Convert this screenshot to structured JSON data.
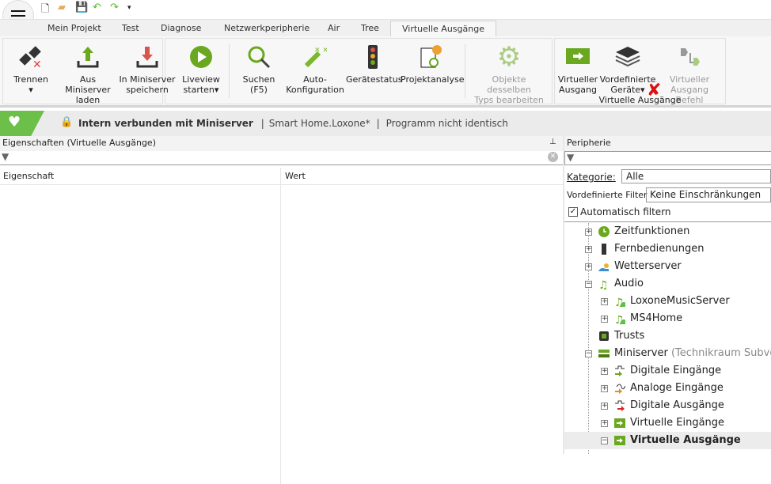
{
  "quick_access": {
    "icons": [
      "new-file-icon",
      "open-folder-icon",
      "save-icon",
      "undo-icon",
      "redo-icon",
      "customize-dropdown-icon"
    ]
  },
  "tabs": [
    "Mein Projekt",
    "Test",
    "Diagnose",
    "Netzwerkperipherie",
    "Air",
    "Tree",
    "Virtuelle Ausgänge"
  ],
  "ribbon": {
    "trennen": "Trennen",
    "aus1": "Aus Miniserver",
    "aus2": "laden",
    "in1": "In Miniserver",
    "in2": "speichern",
    "live1": "Liveview",
    "live2": "starten",
    "such1": "Suchen",
    "such2": "(F5)",
    "auto1": "Auto-",
    "auto2": "Konfiguration",
    "geraet": "Gerätestatus",
    "analyse": "Projektanalyse",
    "obj1": "Objekte desselben",
    "obj2": "Typs bearbeiten",
    "va1": "Virtueller",
    "va2": "Ausgang",
    "vg1": "Vordefinierte",
    "vg2": "Geräte",
    "vb1": "Virtueller",
    "vb2": "Ausgang Befehl",
    "group_label": "Virtuelle Ausgänge"
  },
  "status": {
    "connection": "Intern verbunden mit Miniserver",
    "sep": "|",
    "project": "Smart Home.Loxone*",
    "program": "Programm nicht identisch"
  },
  "properties": {
    "title": "Eigenschaften (Virtuelle Ausgänge)",
    "col1": "Eigenschaft",
    "col2": "Wert"
  },
  "peripherie": {
    "title": "Peripherie",
    "kategorie_label": "Kategorie:",
    "kategorie_value": "Alle",
    "filter_label": "Vordefinierte Filter",
    "filter_value": "Keine Einschränkungen",
    "auto_filter": "Automatisch filtern",
    "auto_filter_checked": true,
    "tree": [
      {
        "label": "Zeitfunktionen",
        "level": 1,
        "exp": "+",
        "icon": "clock-icon"
      },
      {
        "label": "Fernbedienungen",
        "level": 1,
        "exp": "+",
        "icon": "remote-icon"
      },
      {
        "label": "Wetterserver",
        "level": 1,
        "exp": "+",
        "icon": "weather-icon"
      },
      {
        "label": "Audio",
        "level": 1,
        "exp": "-",
        "icon": "music-icon"
      },
      {
        "label": "LoxoneMusicServer",
        "level": 2,
        "exp": "+",
        "icon": "music-server-icon"
      },
      {
        "label": "MS4Home",
        "level": 2,
        "exp": "+",
        "icon": "music-server-icon"
      },
      {
        "label": "Trusts",
        "level": 1,
        "exp": "",
        "icon": "trust-icon"
      },
      {
        "label": "Miniserver",
        "suffix": " (Technikraum Subvert",
        "level": 1,
        "exp": "-",
        "icon": "miniserver-icon"
      },
      {
        "label": "Digitale Eingänge",
        "level": 2,
        "exp": "+",
        "icon": "digital-input-icon"
      },
      {
        "label": "Analoge Eingänge",
        "level": 2,
        "exp": "+",
        "icon": "analog-input-icon"
      },
      {
        "label": "Digitale Ausgänge",
        "level": 2,
        "exp": "+",
        "icon": "digital-output-icon"
      },
      {
        "label": "Virtuelle Eingänge",
        "level": 2,
        "exp": "+",
        "icon": "virtual-input-icon"
      },
      {
        "label": "Virtuelle Ausgänge",
        "level": 2,
        "exp": "-",
        "icon": "virtual-output-icon",
        "selected": true
      }
    ]
  }
}
